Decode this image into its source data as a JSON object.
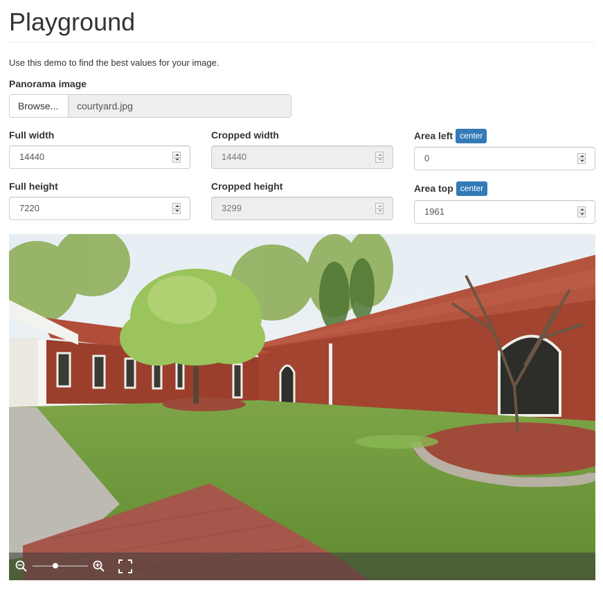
{
  "title": "Playground",
  "intro": "Use this demo to find the best values for your image.",
  "panorama": {
    "label": "Panorama image",
    "browse_label": "Browse...",
    "file_name": "courtyard.jpg"
  },
  "fields": {
    "full_width": {
      "label": "Full width",
      "value": "14440"
    },
    "full_height": {
      "label": "Full height",
      "value": "7220"
    },
    "cropped_width": {
      "label": "Cropped width",
      "value": "14440",
      "disabled": true
    },
    "cropped_height": {
      "label": "Cropped height",
      "value": "3299",
      "disabled": true
    },
    "area_left": {
      "label": "Area left",
      "value": "0",
      "badge": "center"
    },
    "area_top": {
      "label": "Area top",
      "value": "1961",
      "badge": "center"
    }
  },
  "viewer": {
    "scene": "courtyard panorama",
    "zoom_level": 0.4,
    "controls": [
      "zoom-out-icon",
      "zoom-slider",
      "zoom-in-icon",
      "fullscreen-icon"
    ]
  },
  "colors": {
    "accent": "#337ab7",
    "brick": "#9b3f2c",
    "roof": "#b4533f",
    "grass": "#6e9a3a"
  }
}
